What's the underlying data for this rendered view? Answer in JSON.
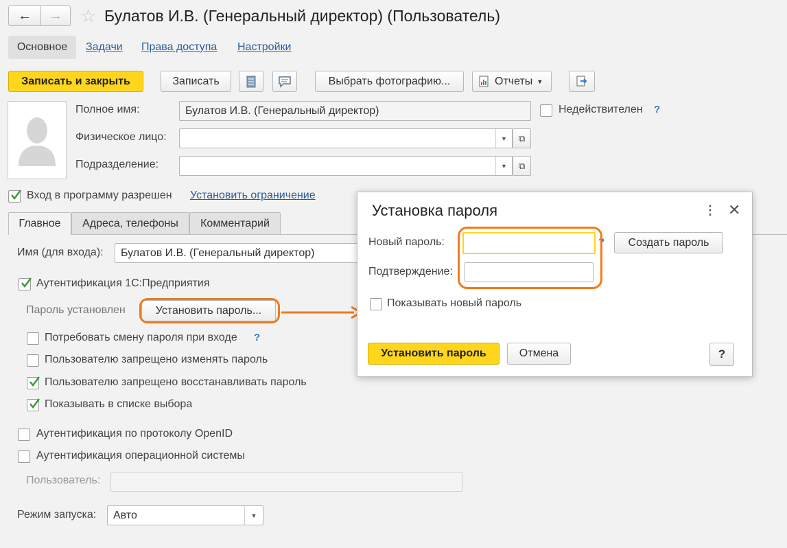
{
  "window": {
    "title": "Булатов И.В. (Генеральный директор) (Пользователь)"
  },
  "nav_tabs": [
    "Основное",
    "Задачи",
    "Права доступа",
    "Настройки"
  ],
  "toolbar": {
    "save_close": "Записать и закрыть",
    "save": "Записать",
    "choose_photo": "Выбрать фотографию...",
    "reports": "Отчеты"
  },
  "header_fields": {
    "full_name_label": "Полное имя:",
    "full_name_value": "Булатов И.В. (Генеральный директор)",
    "inactive_label": "Недействителен",
    "person_label": "Физическое лицо:",
    "department_label": "Подразделение:"
  },
  "login": {
    "allowed_label": "Вход в программу разрешен",
    "set_restriction_link": "Установить ограничение"
  },
  "content_tabs": [
    "Главное",
    "Адреса, телефоны",
    "Комментарий"
  ],
  "main": {
    "login_name_label": "Имя (для входа):",
    "login_name_value": "Булатов И.В. (Генеральный директор)",
    "auth_1c_label": "Аутентификация 1С:Предприятия",
    "password_set_label": "Пароль установлен",
    "set_password_button": "Установить пароль...",
    "require_change_label": "Потребовать смену пароля при входе",
    "forbid_change_label": "Пользователю запрещено изменять пароль",
    "forbid_restore_label": "Пользователю запрещено восстанавливать пароль",
    "show_in_list_label": "Показывать в списке выбора",
    "openid_label": "Аутентификация по протоколу OpenID",
    "os_auth_label": "Аутентификация операционной системы",
    "user_label": "Пользователь:",
    "launch_mode_label": "Режим запуска:",
    "launch_mode_value": "Авто"
  },
  "checkboxes": {
    "inactive": false,
    "login_allowed": true,
    "auth_1c": true,
    "require_change": false,
    "forbid_change": false,
    "forbid_restore": true,
    "show_in_list": true,
    "openid": false,
    "os_auth": false,
    "show_new_password": false
  },
  "dialog": {
    "title": "Установка пароля",
    "new_password_label": "Новый пароль:",
    "new_password_value": "",
    "confirm_label": "Подтверждение:",
    "confirm_value": "",
    "create_password_button": "Создать пароль",
    "show_new_password_label": "Показывать новый пароль",
    "set_password_button": "Установить пароль",
    "cancel_button": "Отмена",
    "help_button": "?"
  },
  "help_mark": "?",
  "colors": {
    "accent_yellow": "#ffd61c",
    "link_blue": "#2a5c9a",
    "highlight_orange": "#f07b1c",
    "check_green": "#3a9a3a"
  }
}
